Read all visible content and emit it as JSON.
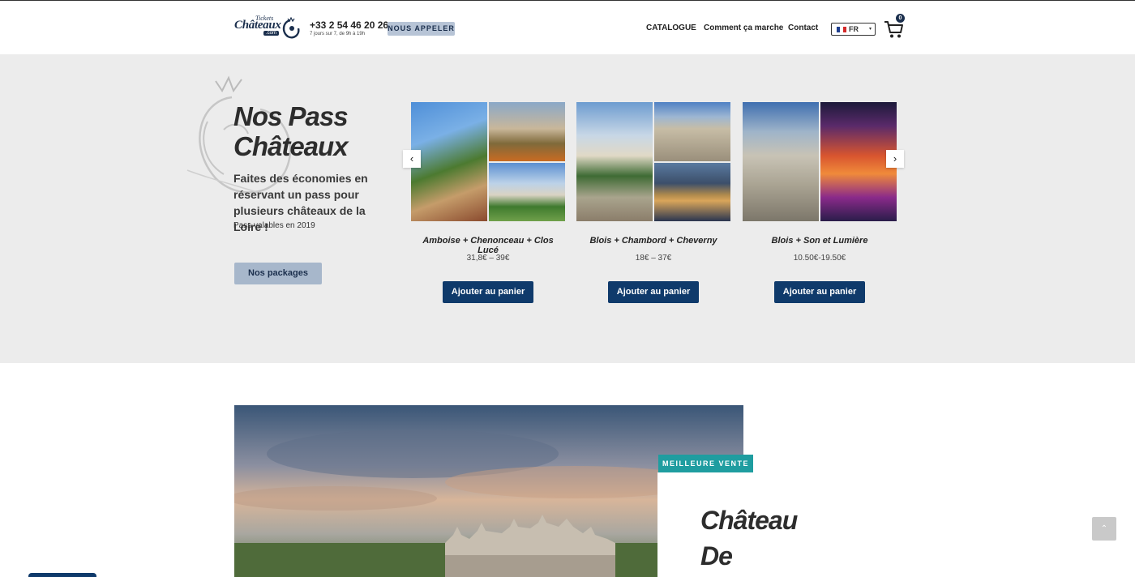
{
  "header": {
    "logo": {
      "top": "Tickets",
      "main": "Châteaux",
      "suffix": ".com"
    },
    "phone": "+33 2 54 46 20 26",
    "phone_hours": "7 jours sur 7, de 9h à 19h",
    "call_button": "NOUS APPELER",
    "nav": [
      "CATALOGUE",
      "Comment ça marche",
      "Contact"
    ],
    "language": "FR",
    "cart_count": "0"
  },
  "pass_section": {
    "title": "Nos Pass Châteaux",
    "description": "Faites des économies en réservant un pass pour plusieurs châteaux de la Loire !",
    "validity": "Pass valables en 2019",
    "packages_button": "Nos packages",
    "products": [
      {
        "name": "Amboise + Chenonceau + Clos Lucé",
        "price": "31,8€ – 39€",
        "button": "Ajouter au panier"
      },
      {
        "name": "Blois + Chambord + Cheverny",
        "price": "18€ – 37€",
        "button": "Ajouter au panier"
      },
      {
        "name": "Blois + Son et Lumière",
        "price": "10.50€-19.50€",
        "button": "Ajouter au panier"
      }
    ],
    "prev_arrow": "‹",
    "next_arrow": "›"
  },
  "featured": {
    "badge": "MEILLEURE VENTE",
    "title": "Château De"
  },
  "icons": {
    "cart": "cart-icon",
    "scroll_top": "chevron-up-icon",
    "prev": "chevron-left-icon",
    "next": "chevron-right-icon"
  },
  "colors": {
    "brand_dark": "#0f3a6b",
    "brand_light": "#a7b7cb",
    "badge_teal": "#1f9da0",
    "section_bg": "#ececec"
  }
}
